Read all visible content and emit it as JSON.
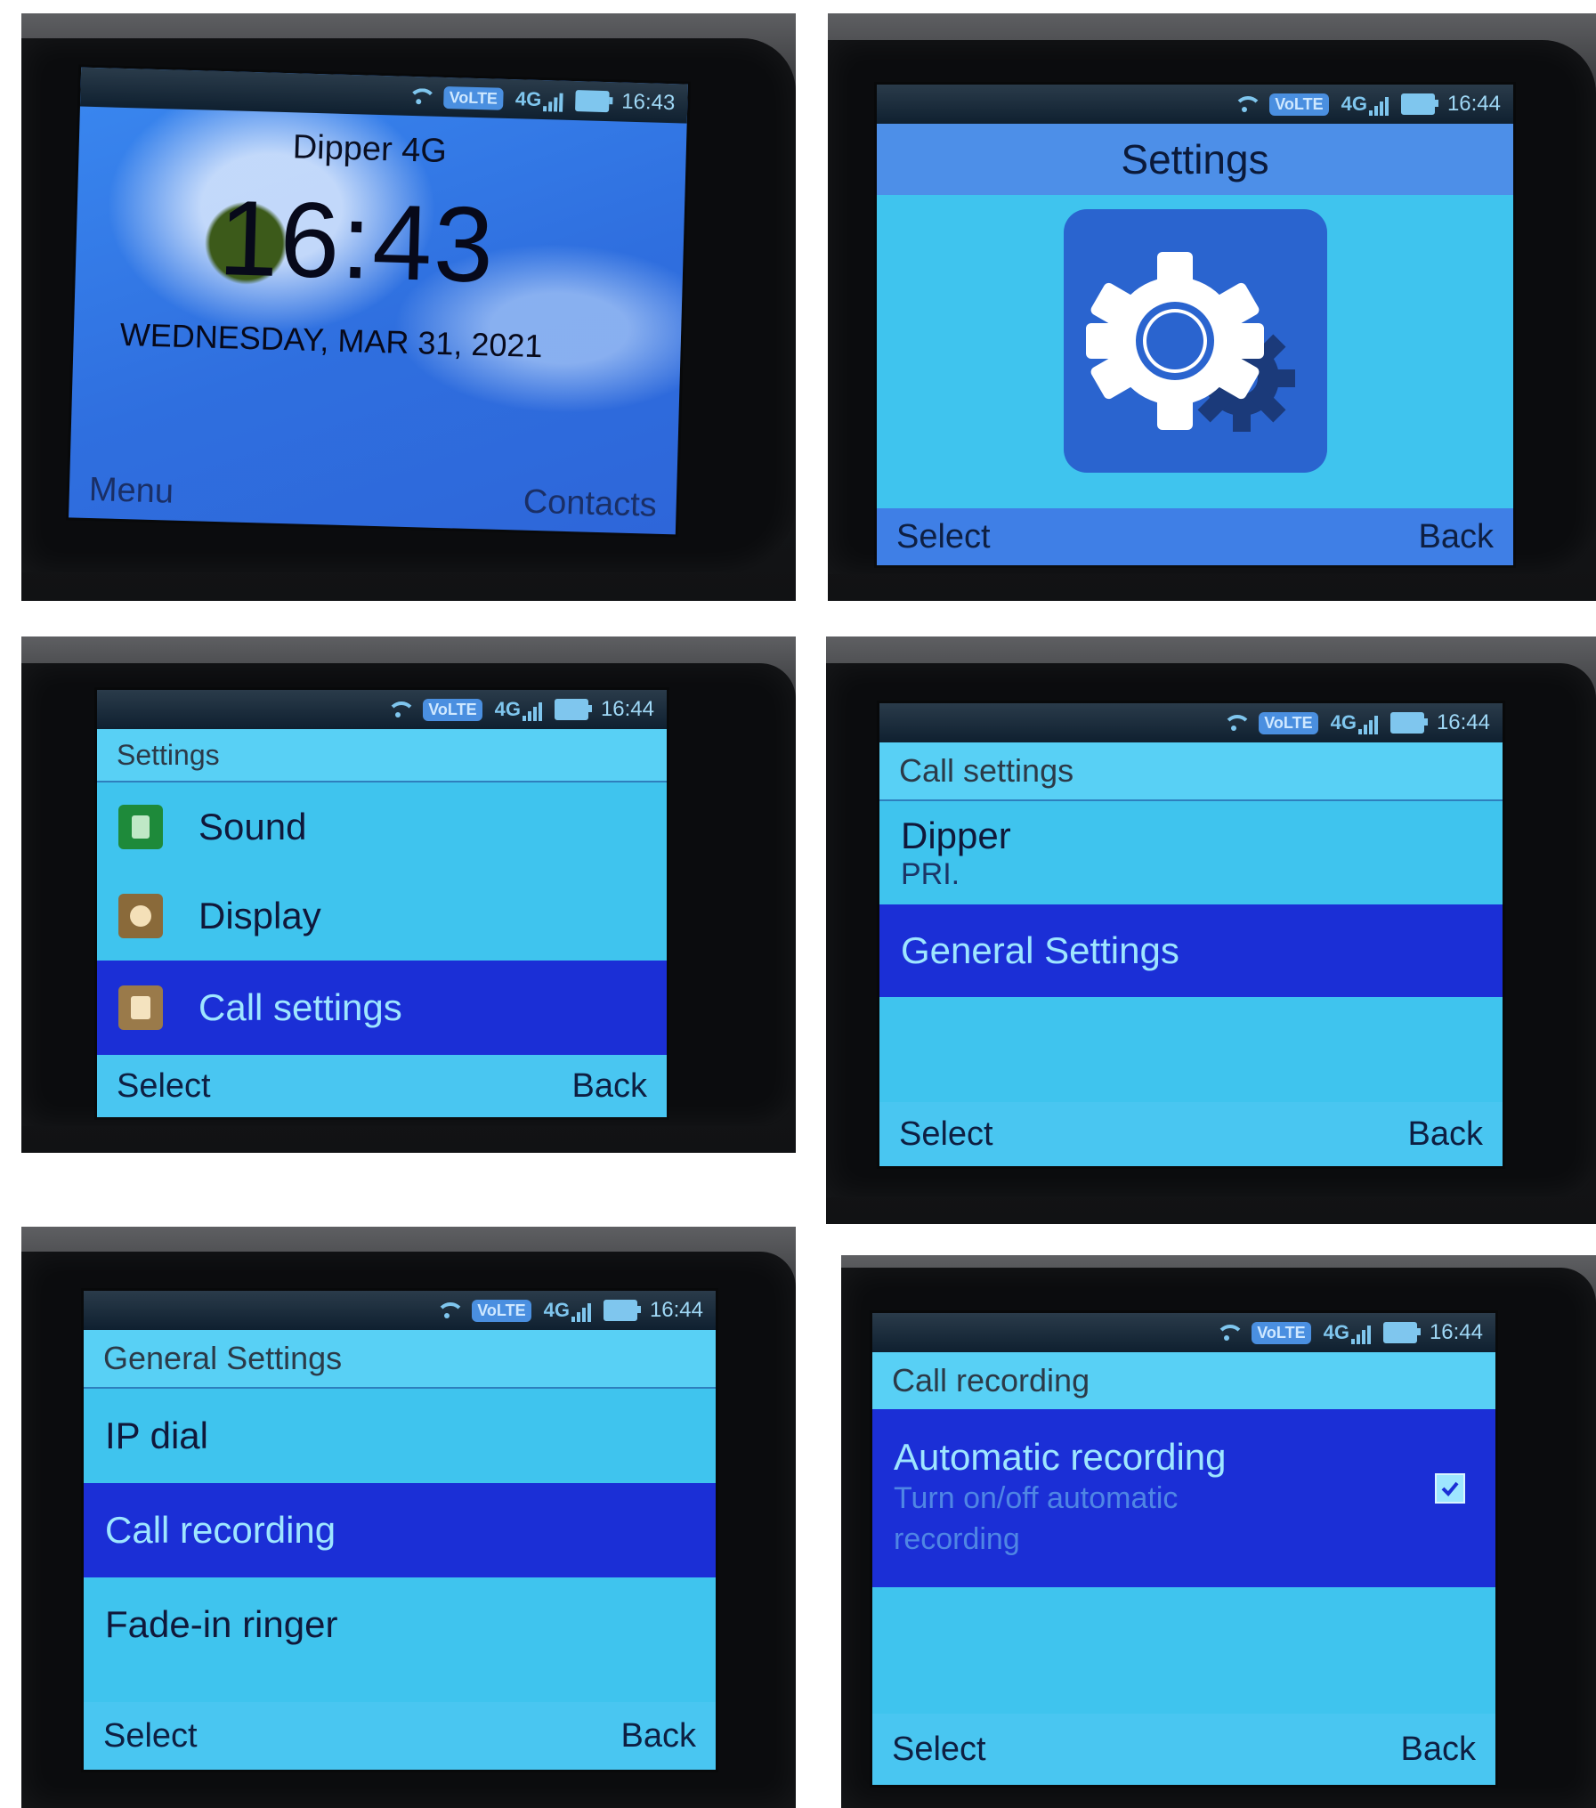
{
  "status_bar": {
    "volte": "VoLTE",
    "network": "4G",
    "times": [
      "16:43",
      "16:44",
      "16:44",
      "16:44",
      "16:44",
      "16:44"
    ]
  },
  "panels": {
    "home": {
      "carrier": "Dipper 4G",
      "clock": "16:43",
      "date": "WEDNESDAY, MAR 31, 2021",
      "left_softkey": "Menu",
      "right_softkey": "Contacts"
    },
    "settings_icon_screen": {
      "title": "Settings",
      "left_softkey": "Select",
      "right_softkey": "Back"
    },
    "settings_list": {
      "header": "Settings",
      "items": [
        "Sound",
        "Display",
        "Call settings"
      ],
      "selected_index": 2,
      "left_softkey": "Select",
      "right_softkey": "Back"
    },
    "call_settings": {
      "header": "Call settings",
      "item1": "Dipper",
      "item1_sub": "PRI.",
      "item2": "General Settings",
      "selected_index": 1,
      "left_softkey": "Select",
      "right_softkey": "Back"
    },
    "general_settings": {
      "header": "General Settings",
      "items": [
        "IP dial",
        "Call recording",
        "Fade-in ringer"
      ],
      "selected_index": 1,
      "left_softkey": "Select",
      "right_softkey": "Back"
    },
    "call_recording": {
      "header": "Call recording",
      "item": "Automatic recording",
      "item_sub": "Turn on/off automatic recording",
      "checked": true,
      "left_softkey": "Select",
      "right_softkey": "Back"
    }
  },
  "colors": {
    "screen_bg": "#3fc4ee",
    "selection": "#1b2fd6",
    "home_bg": "#2f6fdf",
    "gear_tile": "#2a64cf"
  }
}
